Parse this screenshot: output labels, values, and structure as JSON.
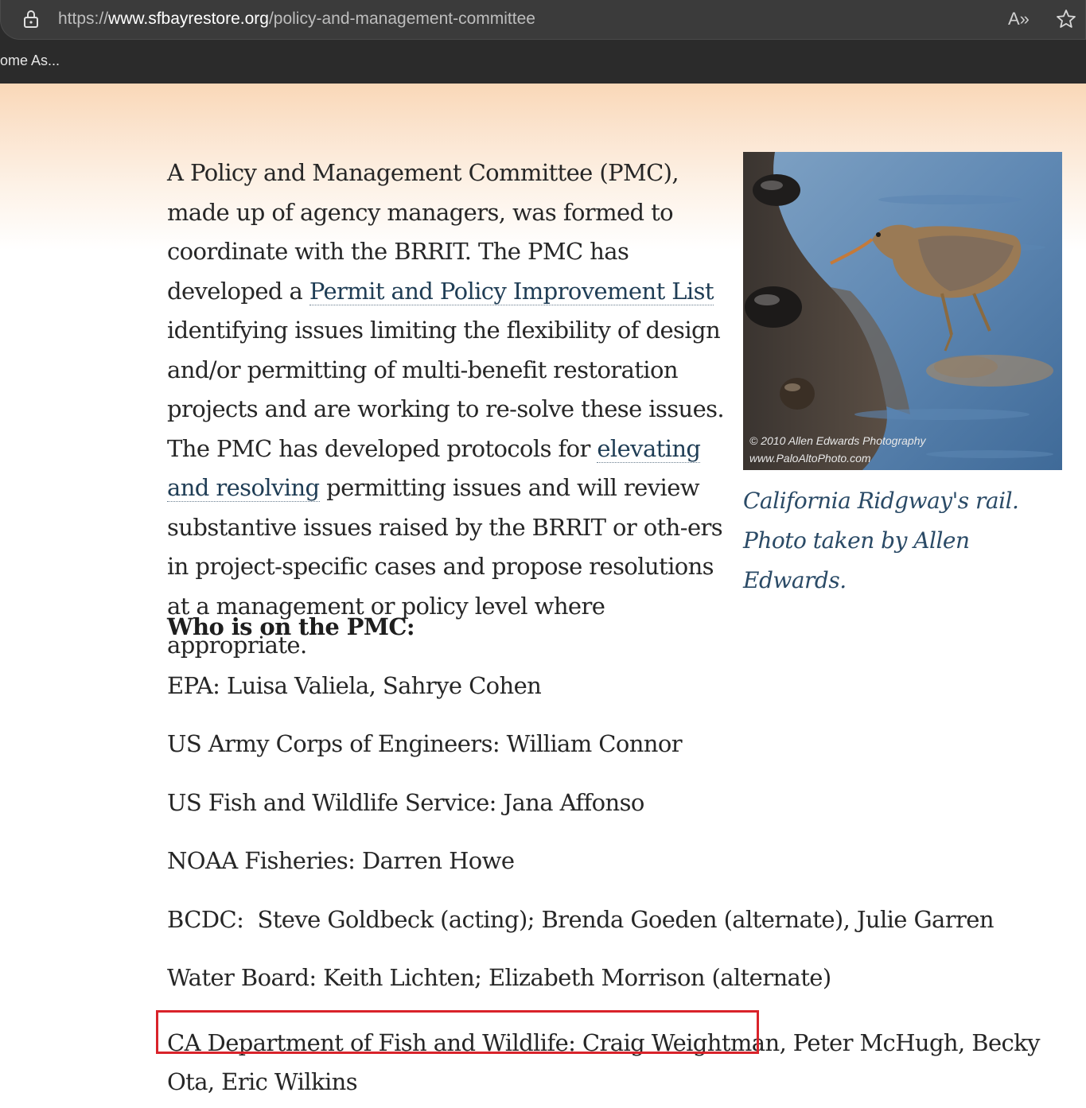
{
  "browser": {
    "url_scheme": "https://",
    "url_host": "www.sfbayrestore.org",
    "url_path": "/policy-and-management-committee",
    "read_aloud_label": "A»",
    "bookmark_label": "ome As..."
  },
  "article": {
    "intro_1": "A Policy and Management Committee (PMC), made up of agency managers, was formed to coordinate with the BRRIT. The PMC has developed a ",
    "link_1": "Permit and Policy Improvement List",
    "intro_2": " identifying issues limiting the flexibility of design and/or permitting of multi-benefit restoration projects and are working to re-solve these issues. The PMC has developed protocols for ",
    "link_2": "elevating and resolving",
    "intro_3": " permitting issues and will review substantive issues raised by the BRRIT or oth-ers in project-specific cases and propose resolutions at a management or policy level where appropriate.",
    "photo_watermark_1": "© 2010 Allen Edwards Photography",
    "photo_watermark_2": "www.PaloAltoPhoto.com",
    "caption": "California Ridgway's rail. Photo taken by Allen Edwards.",
    "heading": "Who is on the PMC:",
    "members": [
      "EPA: Luisa Valiela, Sahrye Cohen",
      "US Army Corps of Engineers: William Connor",
      "US Fish and Wildlife Service: Jana Affonso",
      "NOAA Fisheries: Darren Howe",
      "BCDC:  Steve Goldbeck (acting); Brenda Goeden (alternate), Julie Garren",
      "Water Board: Keith Lichten; Elizabeth Morrison (alternate)",
      "CA Department of Fish and Wildlife: Craig Weightman, Peter McHugh, Becky Ota, Eric Wilkins"
    ]
  }
}
